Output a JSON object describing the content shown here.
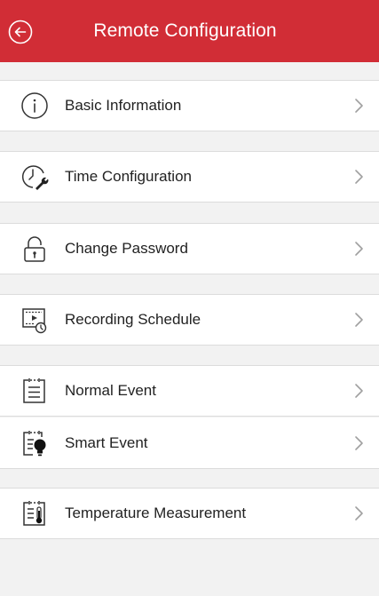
{
  "header": {
    "title": "Remote Configuration",
    "back_icon": "back-arrow-icon",
    "background": "#d12d36"
  },
  "items": [
    {
      "label": "Basic Information",
      "icon": "info-icon"
    },
    {
      "label": "Time Configuration",
      "icon": "clock-wrench-icon"
    },
    {
      "label": "Change Password",
      "icon": "lock-icon"
    },
    {
      "label": "Recording Schedule",
      "icon": "recording-schedule-icon"
    },
    {
      "label": "Normal Event",
      "icon": "normal-event-icon"
    },
    {
      "label": "Smart Event",
      "icon": "smart-event-icon"
    },
    {
      "label": "Temperature Measurement",
      "icon": "temperature-icon"
    }
  ]
}
